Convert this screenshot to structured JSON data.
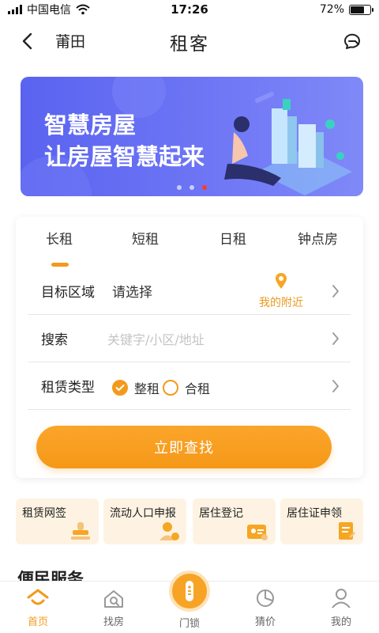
{
  "status_bar": {
    "carrier": "中国电信",
    "time": "17:26",
    "battery": "72%",
    "battery_level": 0.72
  },
  "nav": {
    "city": "莆田",
    "title": "租客"
  },
  "banner": {
    "line1": "智慧房屋",
    "line2": "让房屋智慧起来",
    "dot_count": 3,
    "active_dot": 2
  },
  "search": {
    "tabs": [
      "长租",
      "短租",
      "日租",
      "钟点房"
    ],
    "active_tab": 0,
    "area": {
      "label": "目标区域",
      "value": "请选择",
      "nearby": "我的附近"
    },
    "keyword": {
      "label": "搜索",
      "placeholder": "关键字/小区/地址"
    },
    "rent_type": {
      "label": "租赁类型",
      "options": [
        "整租",
        "合租"
      ],
      "selected": 0
    },
    "button": "立即查找"
  },
  "services": [
    "租赁网签",
    "流动人口申报",
    "居住登记",
    "居住证申领"
  ],
  "section_title": "便民服务",
  "tab_bar": {
    "items": [
      "首页",
      "找房",
      "门锁",
      "猜价",
      "我的"
    ],
    "active": 0
  },
  "colors": {
    "accent": "#f39a1c",
    "banner": "#5a63f0",
    "service_bg": "#fef3e2"
  }
}
